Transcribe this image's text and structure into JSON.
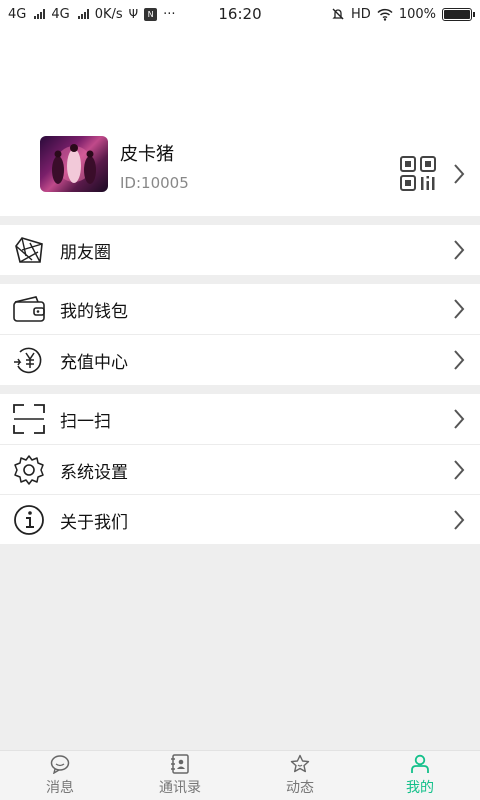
{
  "status_bar": {
    "net1": "4G",
    "net2": "4G",
    "speed": "0K/s",
    "usb_glyph": "Ψ",
    "app_badge": "N",
    "more": "···",
    "time": "16:20",
    "hd": "HD",
    "battery_text": "100%",
    "battery_level": 1.0
  },
  "profile": {
    "nickname": "皮卡猪",
    "id": "ID:10005",
    "qr_icon": "qr-code-icon",
    "chevron_icon": "chevron-right-icon"
  },
  "menu": {
    "moments": {
      "label": "朋友圈",
      "icon": "aperture-icon"
    },
    "wallet": {
      "label": "我的钱包",
      "icon": "wallet-icon"
    },
    "recharge": {
      "label": "充值中心",
      "icon": "recharge-icon"
    },
    "scan": {
      "label": "扫一扫",
      "icon": "scan-icon"
    },
    "settings": {
      "label": "系统设置",
      "icon": "gear-icon"
    },
    "about": {
      "label": "关于我们",
      "icon": "info-icon"
    }
  },
  "tabs": [
    {
      "label": "消息",
      "icon": "chat-bubble-icon",
      "active": false
    },
    {
      "label": "通讯录",
      "icon": "contacts-book-icon",
      "active": false
    },
    {
      "label": "动态",
      "icon": "star-icon",
      "active": false
    },
    {
      "label": "我的",
      "icon": "person-icon",
      "active": true
    }
  ],
  "colors": {
    "accent": "#13c08a",
    "separator": "#eeeeee",
    "muted_text": "#888888"
  }
}
